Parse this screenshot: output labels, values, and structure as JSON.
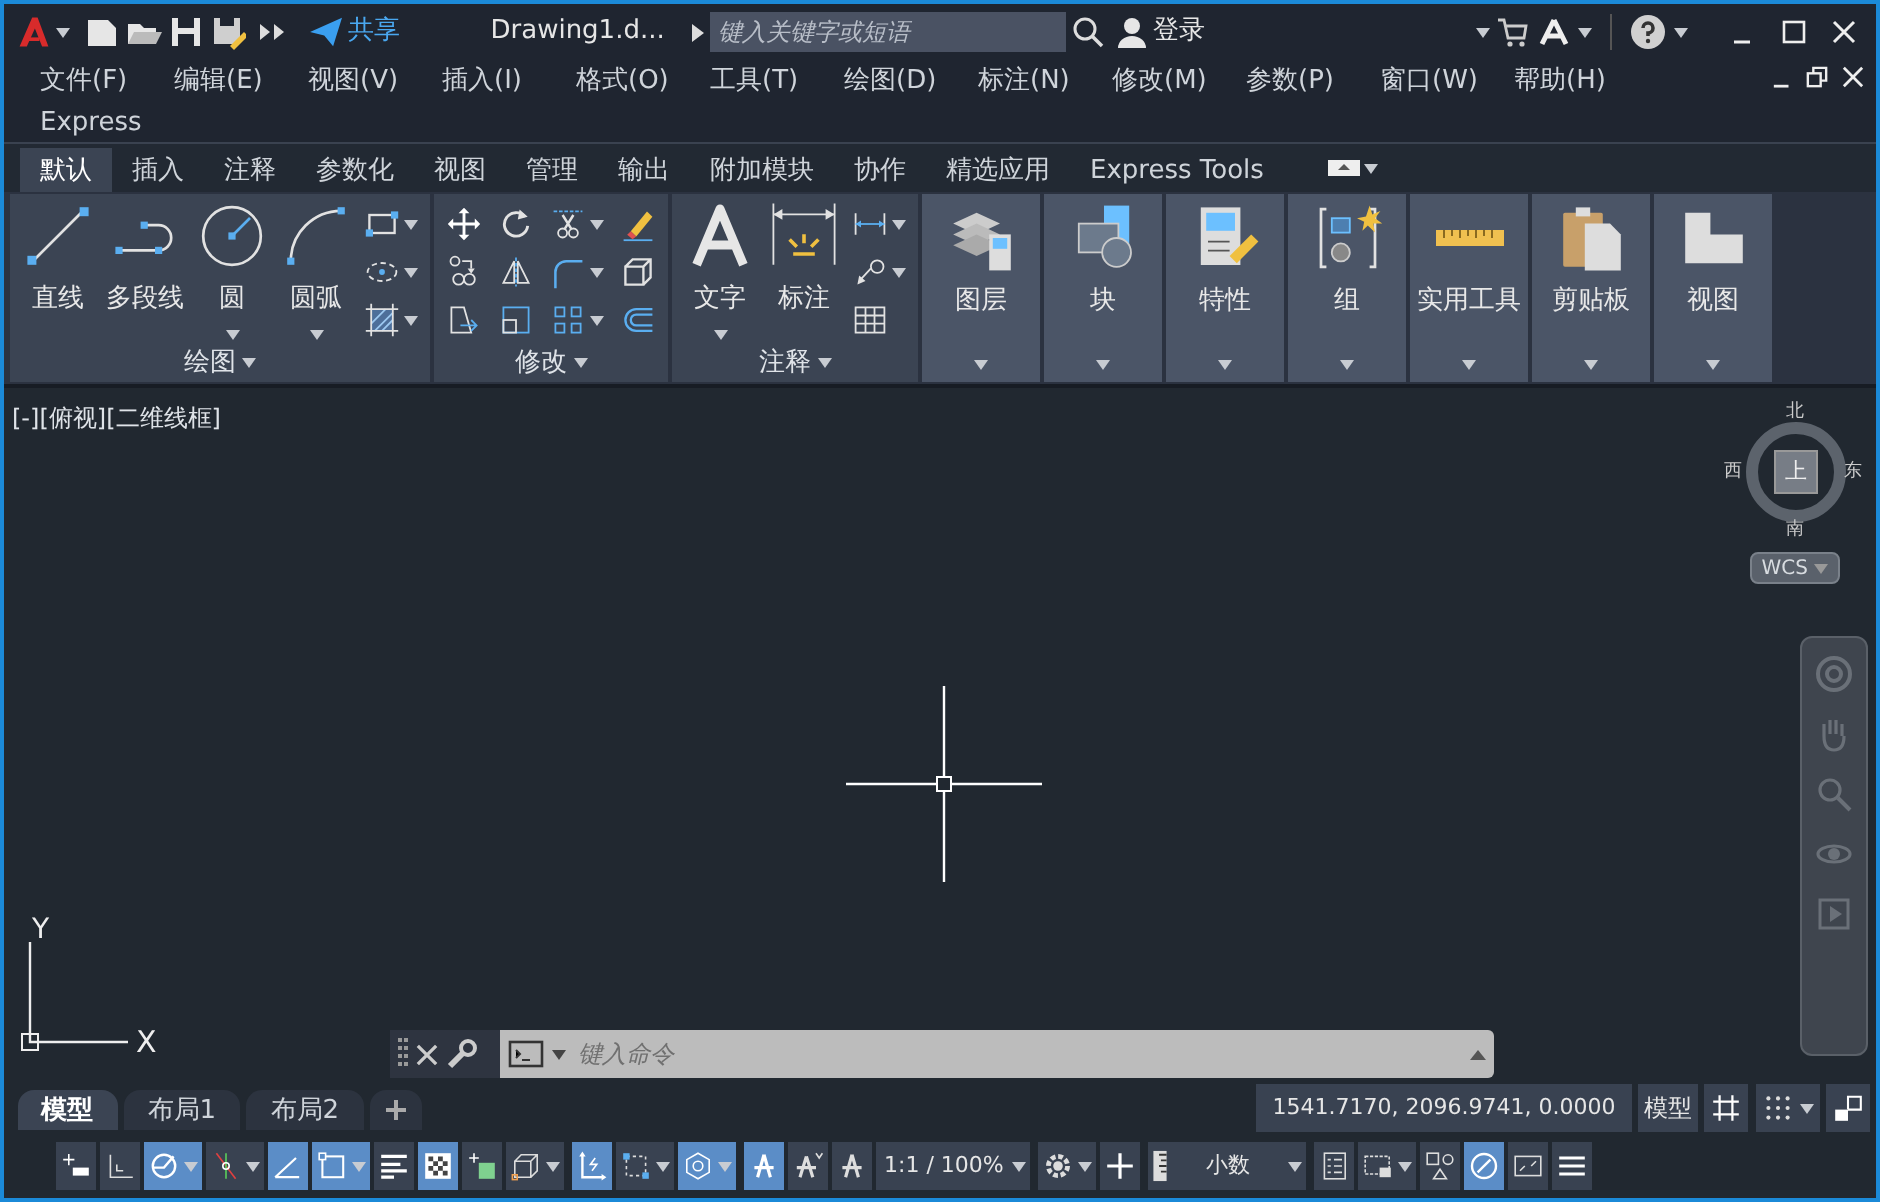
{
  "title_bar": {
    "share": "共享",
    "title": "Drawing1.d...",
    "search": {
      "placeholder": "键入关键字或短语"
    },
    "login": "登录"
  },
  "menu_bar": [
    "文件(F)",
    "编辑(E)",
    "视图(V)",
    "插入(I)",
    "格式(O)",
    "工具(T)",
    "绘图(D)",
    "标注(N)",
    "修改(M)",
    "参数(P)",
    "窗口(W)",
    "帮助(H)",
    "Express"
  ],
  "ribbon_tabs": [
    {
      "label": "默认",
      "selected": true
    },
    {
      "label": "插入",
      "selected": false
    },
    {
      "label": "注释",
      "selected": false
    },
    {
      "label": "参数化",
      "selected": false
    },
    {
      "label": "视图",
      "selected": false
    },
    {
      "label": "管理",
      "selected": false
    },
    {
      "label": "输出",
      "selected": false
    },
    {
      "label": "附加模块",
      "selected": false
    },
    {
      "label": "协作",
      "selected": false
    },
    {
      "label": "精选应用",
      "selected": false
    },
    {
      "label": "Express Tools",
      "selected": false
    }
  ],
  "ribbon_panels": [
    {
      "kind": "draw",
      "title": "绘图",
      "tools": [
        {
          "kind": "line",
          "label": "直线",
          "dropdown": false
        },
        {
          "kind": "polyline",
          "label": "多段线",
          "dropdown": false
        },
        {
          "kind": "circle",
          "label": "圆",
          "dropdown": true
        },
        {
          "kind": "arc",
          "label": "圆弧",
          "dropdown": true
        }
      ],
      "small_tools": [
        {
          "kind": "rect",
          "dropdown": true
        },
        {
          "kind": "ellipse",
          "dropdown": true
        },
        {
          "kind": "hatch",
          "dropdown": true
        }
      ]
    },
    {
      "kind": "modify",
      "title": "修改",
      "small_tools": [
        {
          "kind": "move",
          "dropdown": false
        },
        {
          "kind": "rotate",
          "dropdown": false
        },
        {
          "kind": "trim",
          "dropdown": true
        },
        {
          "kind": "erase",
          "dropdown": false
        },
        {
          "kind": "copy",
          "dropdown": false
        },
        {
          "kind": "mirror",
          "dropdown": false
        },
        {
          "kind": "fillet",
          "dropdown": true
        },
        {
          "kind": "cube",
          "dropdown": false
        },
        {
          "kind": "stretch",
          "dropdown": false
        },
        {
          "kind": "scale",
          "dropdown": false
        },
        {
          "kind": "array",
          "dropdown": true
        },
        {
          "kind": "offset",
          "dropdown": false
        }
      ]
    },
    {
      "kind": "annotation",
      "title": "注释",
      "tools": [
        {
          "kind": "text",
          "label": "文字",
          "dropdown": true
        },
        {
          "kind": "dimension",
          "label": "标注",
          "dropdown": false
        }
      ],
      "small_tools": [
        {
          "kind": "dim",
          "dropdown": true
        },
        {
          "kind": "leader",
          "dropdown": true
        },
        {
          "kind": "table",
          "dropdown": false
        }
      ]
    },
    {
      "kind": "layers",
      "title": "图层"
    },
    {
      "kind": "block",
      "title": "块"
    },
    {
      "kind": "properties",
      "title": "特性"
    },
    {
      "kind": "group",
      "title": "组"
    },
    {
      "kind": "utilities",
      "title": "实用工具"
    },
    {
      "kind": "clipboard",
      "title": "剪贴板"
    },
    {
      "kind": "view",
      "title": "视图"
    }
  ],
  "viewport_controls": [
    "[-]",
    "[俯视]",
    "[二维线框]"
  ],
  "viewcube": {
    "north": "北",
    "south": "南",
    "east": "东",
    "west": "西",
    "face": "上",
    "coordinate_system": "WCS"
  },
  "ucs": {
    "x": "X",
    "y": "Y"
  },
  "command_line": {
    "placeholder": "键入命令"
  },
  "layout_tabs": [
    {
      "label": "模型",
      "selected": true
    },
    {
      "label": "布局1",
      "selected": false
    },
    {
      "label": "布局2",
      "selected": false
    }
  ],
  "status_bar": {
    "coordinates": "1541.7170, 2096.9741, 0.0000",
    "space": "模型",
    "top_tools": [
      {
        "kind": "grid",
        "on": false,
        "dropdown": false
      },
      {
        "kind": "snap",
        "on": false,
        "dropdown": true
      },
      {
        "kind": "quickview",
        "on": false,
        "dropdown": false
      }
    ],
    "groups": [
      {
        "items": [
          {
            "kind": "modeladd",
            "on": false,
            "dropdown": false
          },
          {
            "kind": "gridsnap",
            "on": false,
            "dropdown": false
          },
          {
            "kind": "polar",
            "on": true,
            "dropdown": true
          },
          {
            "kind": "isodraft",
            "on": false,
            "dropdown": true
          },
          {
            "kind": "angle",
            "on": true,
            "dropdown": false
          },
          {
            "kind": "osnap",
            "on": true,
            "dropdown": true
          },
          {
            "kind": "lineweight",
            "on": false,
            "dropdown": false
          },
          {
            "kind": "transparency",
            "on": true,
            "dropdown": false
          },
          {
            "kind": "selcycle",
            "on": false,
            "dropdown": false
          },
          {
            "kind": "osnap3d",
            "on": false,
            "dropdown": true
          }
        ]
      },
      {
        "items": [
          {
            "kind": "ducs",
            "on": true,
            "dropdown": false
          },
          {
            "kind": "selfilter",
            "on": false,
            "dropdown": true
          },
          {
            "kind": "gizmo",
            "on": true,
            "dropdown": true
          }
        ]
      },
      {
        "items": [
          {
            "kind": "annot",
            "on": true,
            "dropdown": false
          },
          {
            "kind": "annotauto",
            "on": false,
            "dropdown": false
          },
          {
            "kind": "annotscale",
            "on": false,
            "dropdown": false
          },
          {
            "kind": "scale",
            "label": "1:1 / 100%",
            "on": false,
            "dropdown": true
          }
        ]
      },
      {
        "items": [
          {
            "kind": "gear",
            "on": false,
            "dropdown": true
          },
          {
            "kind": "plus",
            "on": false,
            "dropdown": false
          }
        ]
      },
      {
        "items": [
          {
            "kind": "units",
            "label": "小数",
            "on": false,
            "dropdown": true
          }
        ]
      },
      {
        "items": [
          {
            "kind": "quickprops",
            "on": false,
            "dropdown": false
          },
          {
            "kind": "lockui",
            "on": false,
            "dropdown": true
          },
          {
            "kind": "isolate",
            "on": false,
            "dropdown": false
          },
          {
            "kind": "hwaccel",
            "on": true,
            "dropdown": false
          },
          {
            "kind": "fullscreen",
            "on": false,
            "dropdown": false
          },
          {
            "kind": "menu",
            "on": false,
            "dropdown": false
          }
        ]
      }
    ]
  }
}
